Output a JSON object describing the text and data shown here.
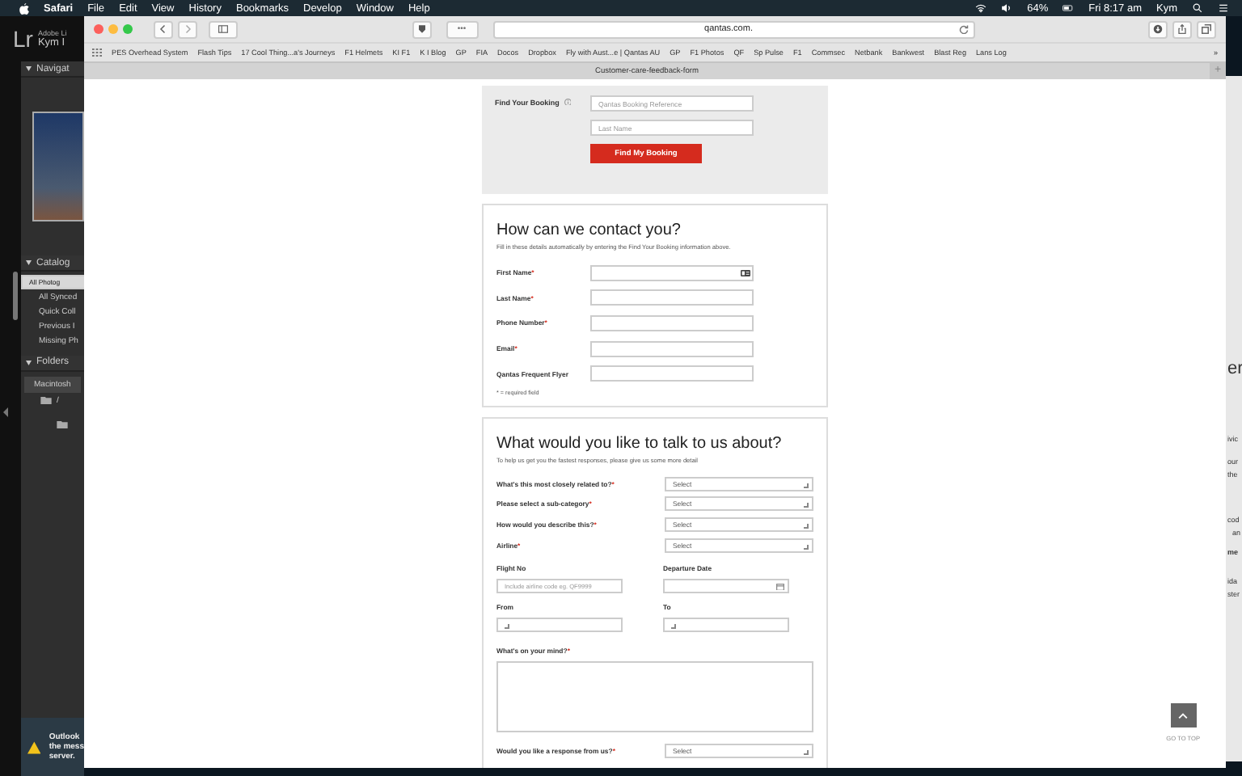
{
  "menu_bar": {
    "app": "Safari",
    "items": [
      "File",
      "Edit",
      "View",
      "History",
      "Bookmarks",
      "Develop",
      "Window",
      "Help"
    ],
    "battery": "64%",
    "clock": "Fri 8:17 am",
    "user": "Kym"
  },
  "lightroom": {
    "logo": "Lr",
    "app_name": "Adobe Li",
    "user": "Kym I",
    "panels": [
      {
        "title": "Navigat",
        "kind": "image"
      },
      {
        "title": "Catalog",
        "kind": "list",
        "items": [
          {
            "label": "All Photog",
            "selected": true
          },
          {
            "label": "All Synced",
            "selected": false
          },
          {
            "label": "Quick Coll",
            "selected": false
          },
          {
            "label": "Previous I",
            "selected": false
          },
          {
            "label": "Missing Ph",
            "selected": false
          }
        ]
      },
      {
        "title": "Folders",
        "kind": "folders",
        "items": [
          {
            "label": "Macintosh",
            "selected": false
          }
        ],
        "path": "/"
      }
    ],
    "notification": {
      "lines": [
        "Outlook",
        "the mess",
        "server."
      ]
    }
  },
  "browser": {
    "url": "qantas.com.",
    "reader": "•••",
    "bookmarks": [
      "PES Overhead System",
      "Flash Tips",
      "17 Cool Thing...a's Journeys",
      "F1 Helmets",
      "KI F1",
      "K I Blog",
      "GP",
      "FIA",
      "Docos",
      "Dropbox",
      "Fly with Aust...e | Qantas AU",
      "GP",
      "F1 Photos",
      "QF",
      "Sp Pulse",
      "F1",
      "Commsec",
      "Netbank",
      "Bankwest",
      "Blast Reg",
      "Lans Log"
    ],
    "more": "»",
    "tab": "Customer-care-feedback-form",
    "new_tab": "+"
  },
  "booking": {
    "label": "Find Your Booking",
    "placeholders": [
      "Qantas Booking Reference",
      "Last Name"
    ],
    "button": "Find My Booking"
  },
  "contact": {
    "title": "How can we contact you?",
    "intro": "Fill in these details automatically by entering the Find Your Booking information above.",
    "fields": [
      {
        "label": "First Name",
        "required_mark": "*",
        "autofill": true
      },
      {
        "label": "Last Name",
        "required_mark": "*",
        "autofill": false
      },
      {
        "label": "Phone Number",
        "required_mark": "*",
        "autofill": false
      },
      {
        "label": "Email",
        "required_mark": "*",
        "autofill": false
      },
      {
        "label": "Qantas Frequent Flyer",
        "autofill": false
      }
    ],
    "footnote": "* = required field"
  },
  "talk": {
    "title": "What would you like to talk to us about?",
    "intro": "To help us get you the fastest responses, please give us some more detail",
    "selects": [
      {
        "label": "What's this most closely related to?",
        "required_mark": "*",
        "value": "Select"
      },
      {
        "label": "Please select a sub-category",
        "required_mark": "*",
        "value": "Select"
      },
      {
        "label": "How would you describe this?",
        "required_mark": "*",
        "value": "Select"
      },
      {
        "label": "Airline",
        "required_mark": "*",
        "value": "Select"
      }
    ],
    "pairs": [
      {
        "label": "Flight No",
        "kind": "text",
        "placeholder": "Include airline code eg. QF9999"
      },
      {
        "label": "Departure Date",
        "kind": "date"
      },
      {
        "label": "From",
        "kind": "select"
      },
      {
        "label": "To",
        "kind": "select"
      }
    ],
    "message": {
      "label": "What's on your mind?",
      "required_mark": "*"
    },
    "response": {
      "label": "Would you like a response from us?",
      "required_mark": "*",
      "value": "Select"
    }
  },
  "go_to_top": "GO TO TOP",
  "background_window": [
    "er",
    "ivic",
    "our",
    "the",
    "cod",
    "an",
    "me",
    "ida",
    "ster"
  ]
}
